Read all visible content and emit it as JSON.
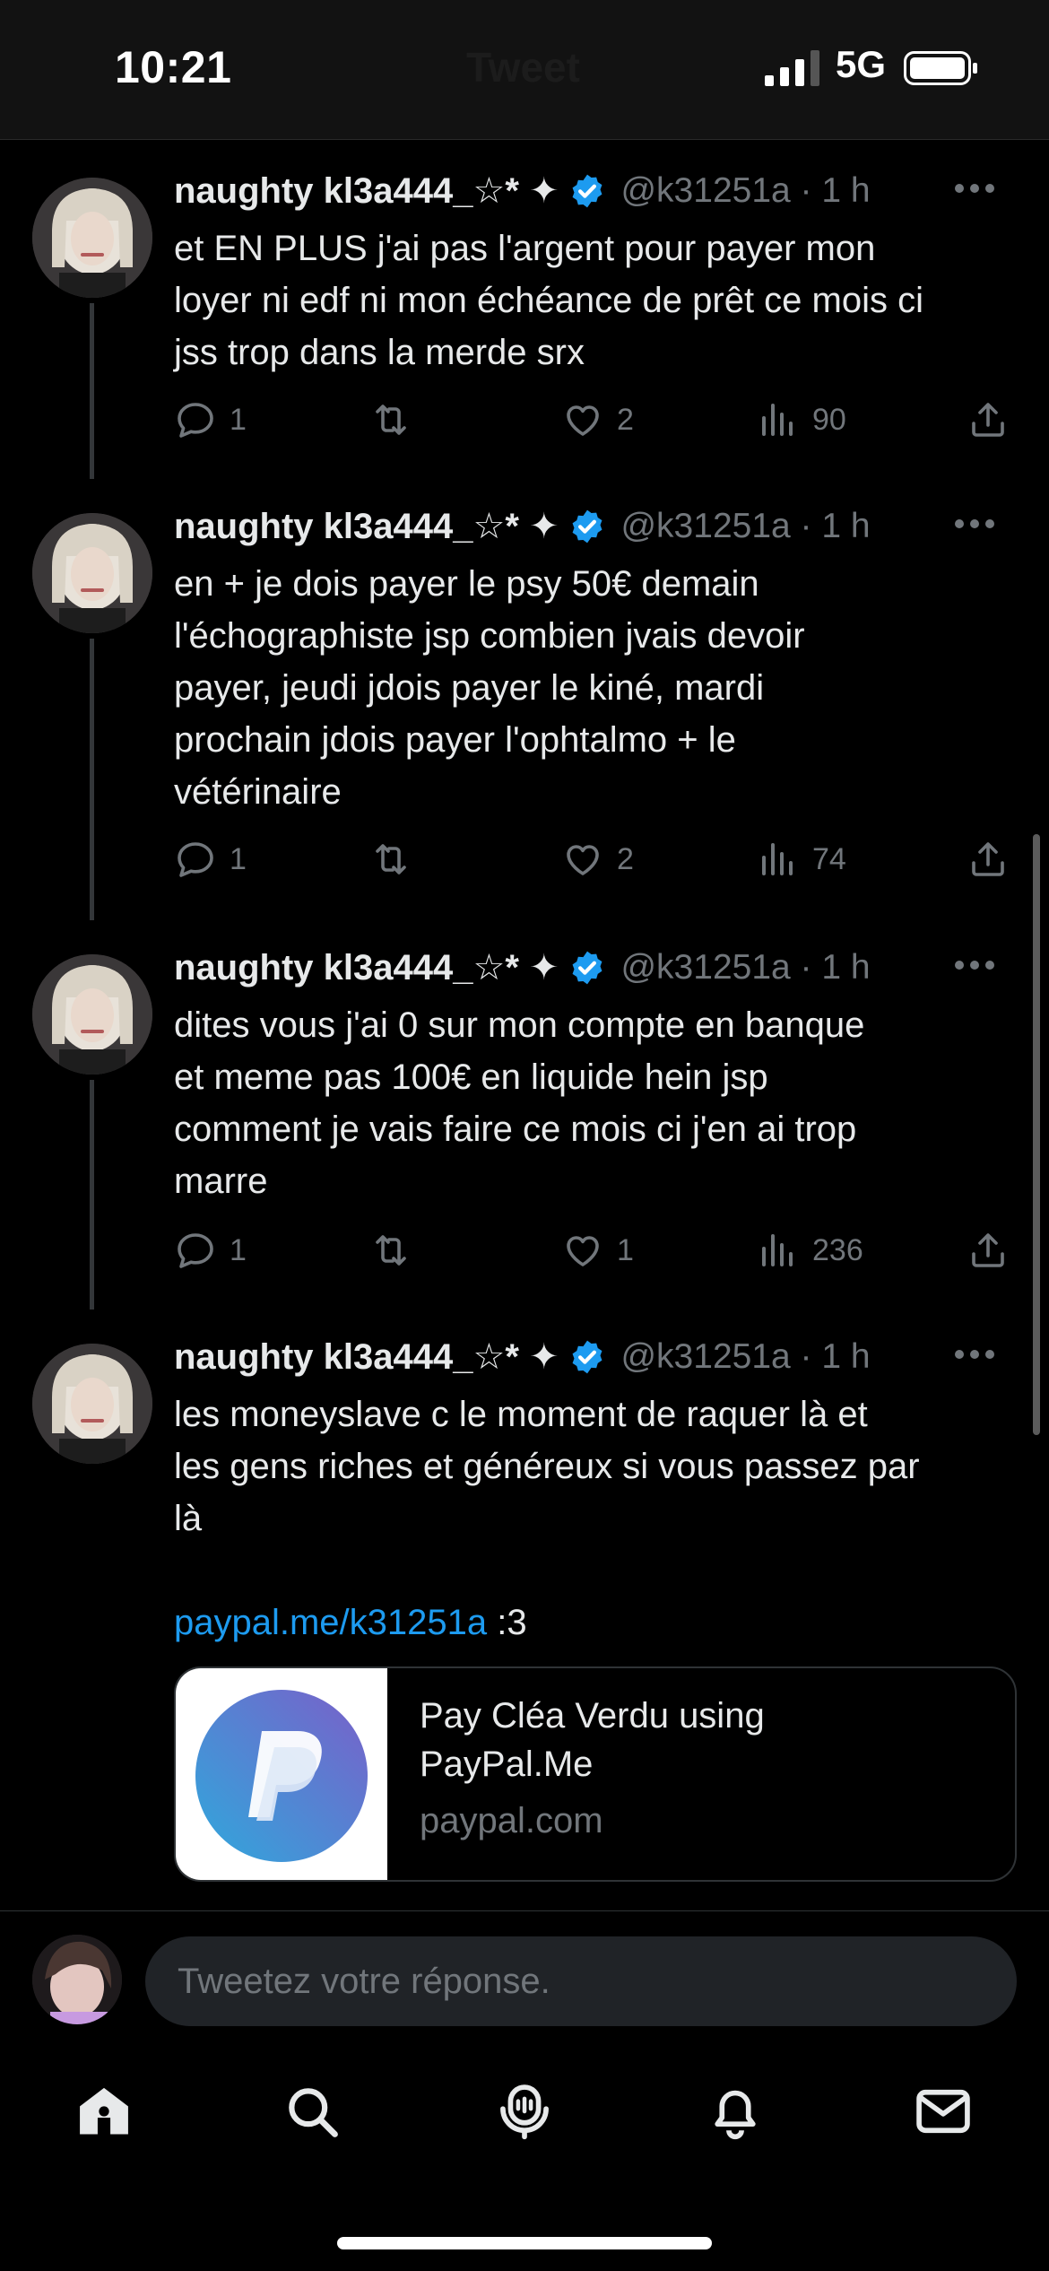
{
  "status_bar": {
    "time": "10:21",
    "network": "5G",
    "ghost_title": "Tweet"
  },
  "tweets": [
    {
      "name": "naughty kl3a444_☆* ✦",
      "handle": "@k31251a · 1 h",
      "text": "et EN PLUS j'ai pas l'argent pour payer mon\nloyer ni edf ni mon échéance de prêt ce mois ci\njss trop dans la merde srx",
      "replies": "1",
      "retweets": "",
      "likes": "2",
      "views": "90"
    },
    {
      "name": "naughty kl3a444_☆* ✦",
      "handle": "@k31251a · 1 h",
      "text": "en + je dois payer le psy 50€ demain\nl'échographiste jsp combien jvais devoir\npayer, jeudi jdois payer le kiné, mardi\nprochain jdois payer l'ophtalmo + le\nvétérinaire",
      "replies": "1",
      "retweets": "",
      "likes": "2",
      "views": "74"
    },
    {
      "name": "naughty kl3a444_☆* ✦",
      "handle": "@k31251a · 1 h",
      "text": "dites vous j'ai 0 sur mon compte en banque\net meme pas 100€ en liquide hein jsp\ncomment je vais faire ce mois ci j'en ai trop\nmarre",
      "replies": "1",
      "retweets": "",
      "likes": "1",
      "views": "236"
    },
    {
      "name": "naughty kl3a444_☆* ✦",
      "handle": "@k31251a · 1 h",
      "text": "les moneyslave c le moment de raquer là et\nles gens riches et généreux si vous passez par\nlà",
      "link": "paypal.me/k31251a",
      "link_suffix": " :3",
      "card": {
        "title": "Pay Cléa Verdu using\nPayPal.Me",
        "domain": "paypal.com"
      }
    }
  ],
  "reply_bar": {
    "placeholder": "Tweetez votre réponse."
  },
  "tab_bar": {
    "icons": [
      "home-icon",
      "search-icon",
      "spaces-icon",
      "notifications-icon",
      "messages-icon"
    ]
  },
  "colors": {
    "background": "#000000",
    "text": "#e7e9ea",
    "secondary": "#71767b",
    "accent": "#1d9bf0",
    "verified": "#1d9bf0"
  }
}
